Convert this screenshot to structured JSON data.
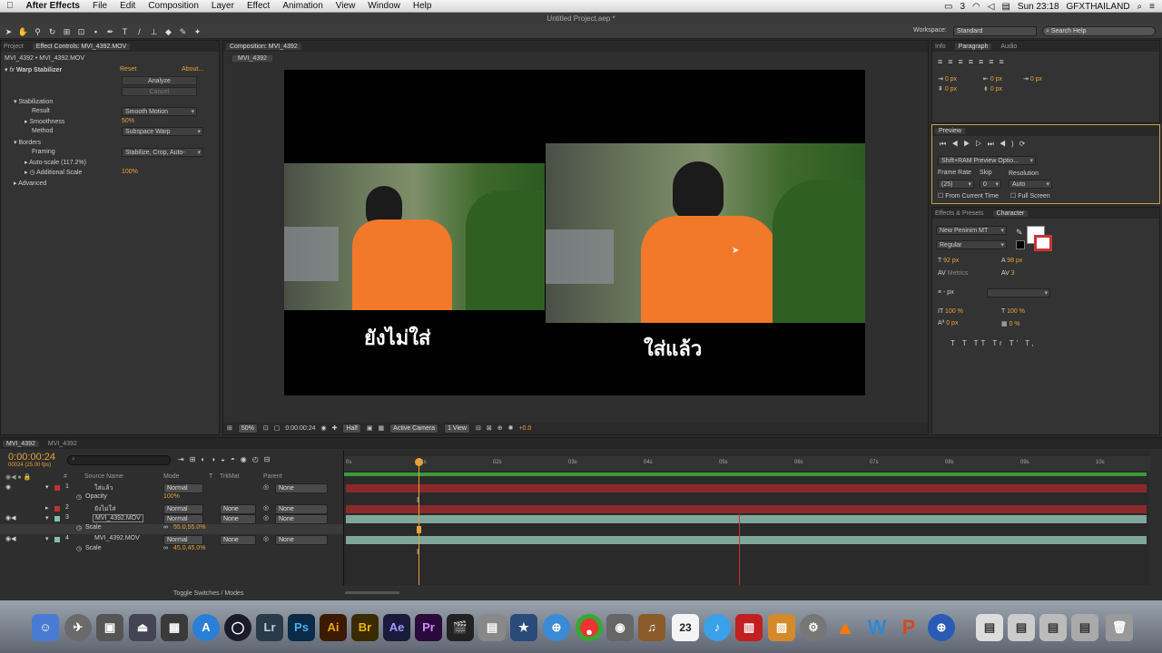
{
  "menubar": {
    "app": "After Effects",
    "items": [
      "File",
      "Edit",
      "Composition",
      "Layer",
      "Effect",
      "Animation",
      "View",
      "Window",
      "Help"
    ],
    "clock": "Sun 23:18",
    "user": "GFXTHAILAND",
    "badge": "3"
  },
  "window_title": "Untitled Project.aep *",
  "toolbar": {
    "workspace_label": "Workspace:",
    "workspace_value": "Standard",
    "search_placeholder": "Search Help"
  },
  "left_panel": {
    "tab_project": "Project",
    "tab_effect_controls": "Effect Controls: MVI_4392.MOV",
    "layer_path": "MVI_4392 • MVI_4392.MOV",
    "effect_name": "Warp Stabilizer",
    "reset": "Reset",
    "about": "About...",
    "analyze": "Analyze",
    "cancel": "Cancel",
    "stabilization": "Stabilization",
    "result_label": "Result",
    "result_value": "Smooth Motion",
    "smoothness_label": "Smoothness",
    "smoothness_value": "50%",
    "method_label": "Method",
    "method_value": "Subspace Warp",
    "borders": "Borders",
    "framing_label": "Framing",
    "framing_value": "Stabilize, Crop, Auto-",
    "autoscale_label": "Auto-scale (117.2%)",
    "additional_scale_label": "Additional Scale",
    "additional_scale_value": "100%",
    "advanced": "Advanced"
  },
  "composition": {
    "tab": "Composition: MVI_4392",
    "subtab": "MVI_4392",
    "caption_left": "ยังไม่ใส่",
    "caption_right": "ใส่แล้ว",
    "zoom": "50%",
    "timecode": "0:00:00:24",
    "resolution": "Half",
    "camera": "Active Camera",
    "view": "1 View",
    "exposure": "+0.0"
  },
  "right_panels": {
    "tabs_top": [
      "Info",
      "Paragraph",
      "Audio"
    ],
    "para_values": [
      "0 px",
      "0 px",
      "0 px",
      "0 px",
      "0 px"
    ],
    "preview_tab": "Preview",
    "preview_mode": "Shift+RAM Preview Optio...",
    "frame_rate_label": "Frame Rate",
    "skip_label": "Skip",
    "resolution_label": "Resolution",
    "frame_rate_value": "(25)",
    "skip_value": "0",
    "resolution_value": "Auto",
    "from_current": "From Current Time",
    "full_screen": "Full Screen",
    "effects_tab": "Effects & Presets",
    "character_tab": "Character",
    "font": "New Peninim MT",
    "style": "Regular",
    "size": "92 px",
    "leading": "98 px",
    "kerning": "Metrics",
    "tracking": "3",
    "stroke": "- px",
    "vscale": "100 %",
    "hscale": "100 %",
    "baseline": "0 px",
    "tsume": "0 %",
    "text_styles": [
      "T",
      "T",
      "TT",
      "Tr",
      "T'",
      "T,"
    ]
  },
  "timeline": {
    "tab_active": "MVI_4392",
    "tab_other": "MVI_4392",
    "timecode": "0:00:00:24",
    "frame_info": "00024 (25.00 fps)",
    "col_source": "Source Name",
    "col_mode": "Mode",
    "col_t": "T",
    "col_trkmat": "TrkMat",
    "col_parent": "Parent",
    "ruler": [
      "0s",
      "01s",
      "02s",
      "03s",
      "04s",
      "05s",
      "06s",
      "07s",
      "08s",
      "09s",
      "10s"
    ],
    "layers": [
      {
        "num": "1",
        "name": "ใส่แล้ว",
        "mode": "Normal",
        "trkmat": "",
        "parent": "None",
        "prop": "Opacity",
        "prop_value": "100%"
      },
      {
        "num": "2",
        "name": "ยังไม่ใส่",
        "mode": "Normal",
        "trkmat": "None",
        "parent": "None"
      },
      {
        "num": "3",
        "name": "MVI_4392.MOV",
        "mode": "Normal",
        "trkmat": "None",
        "parent": "None",
        "prop": "Scale",
        "prop_value": "55.0,55.0%"
      },
      {
        "num": "4",
        "name": "MVI_4392.MOV",
        "mode": "Normal",
        "trkmat": "None",
        "parent": "None",
        "prop": "Scale",
        "prop_value": "45.0,45.0%"
      }
    ],
    "toggle": "Toggle Switches / Modes"
  },
  "dock": {
    "apps": [
      "Lr",
      "Ps",
      "Ai",
      "Br",
      "Ae",
      "Pr"
    ],
    "calendar_day": "23"
  },
  "colors": {
    "accent": "#e8a23a",
    "track_green": "#3a9a3a",
    "track_red": "#8a2a2a",
    "track_teal": "#7fa69a"
  }
}
